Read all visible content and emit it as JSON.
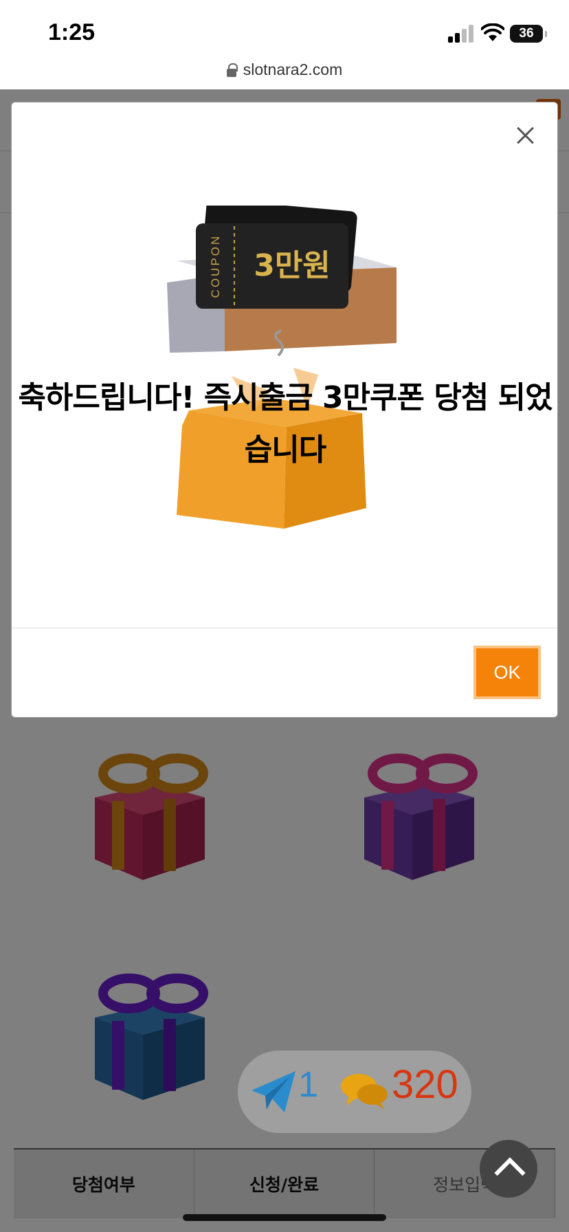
{
  "status_bar": {
    "time": "1:25",
    "battery": "36"
  },
  "browser": {
    "url": "slotnara2.com"
  },
  "modal": {
    "message": "축하드립니다! 즉시출금 3만쿠폰 당첨 되었습니다",
    "coupon_label": "COUPON",
    "coupon_amount": "3만원",
    "ok_label": "OK"
  },
  "bottom_tabs": [
    {
      "label": "당첨여부"
    },
    {
      "label": "신청/완료"
    },
    {
      "label": "정보입력"
    }
  ],
  "floating": {
    "telegram_count": "1",
    "chat_count": "320"
  },
  "colors": {
    "accent": "#f5830a",
    "telegram": "#2a8ccc",
    "chat_count": "#d83510"
  }
}
